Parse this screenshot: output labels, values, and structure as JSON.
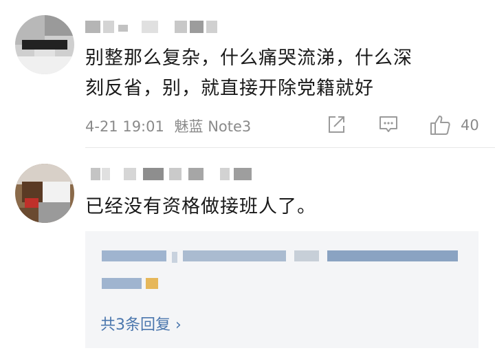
{
  "comments": [
    {
      "text_line1": "别整那么复杂，什么痛哭流涕，什么深",
      "text_line2": "刻反省，别，就直接开除党籍就好",
      "time": "4-21 19:01",
      "device": "魅蓝 Note3",
      "likes": "40",
      "actions": [
        "share-icon",
        "comment-icon",
        "thumbs-up-icon"
      ]
    },
    {
      "text": "已经没有资格做接班人了。",
      "reply_box": {
        "more_replies_label": "共3条回复 ›"
      }
    }
  ],
  "colors": {
    "text": "#1a1a1a",
    "meta": "#8a8a8a",
    "link": "#4a76ad",
    "reply_bg": "#f4f5f7"
  }
}
